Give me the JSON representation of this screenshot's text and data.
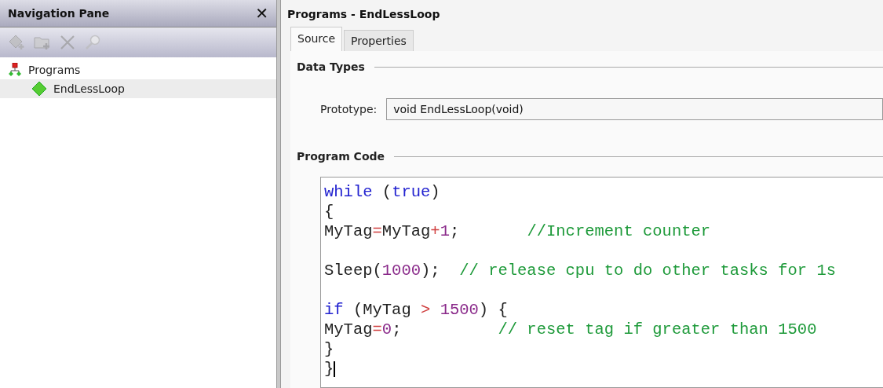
{
  "nav_pane": {
    "title": "Navigation Pane",
    "close": "✕",
    "toolbar": [
      {
        "kind": "add-item",
        "disabled": true
      },
      {
        "kind": "add-folder",
        "disabled": true
      },
      {
        "kind": "delete",
        "disabled": true
      },
      {
        "kind": "search",
        "disabled": true
      }
    ],
    "tree": [
      {
        "label": "Programs",
        "kind": "group",
        "selected": false,
        "children": [
          {
            "label": "EndLessLoop",
            "kind": "program",
            "selected": true
          }
        ]
      }
    ]
  },
  "editor": {
    "title": "Programs - EndLessLoop",
    "tabs": [
      {
        "label": "Source",
        "selected": true
      },
      {
        "label": "Properties",
        "selected": false
      }
    ],
    "data_types": {
      "heading": "Data Types",
      "prototype_label": "Prototype:",
      "prototype_value": "void EndLessLoop(void)"
    },
    "program_code": {
      "heading": "Program Code",
      "blocks": [
        {
          "lines": [
            {
              "tokens": [
                {
                  "kind": "keyword",
                  "text": "while"
                },
                {
                  "kind": "plain",
                  "text": " ("
                },
                {
                  "kind": "keyword",
                  "text": "true"
                },
                {
                  "kind": "plain",
                  "text": ")"
                }
              ]
            },
            {
              "tokens": [
                {
                  "kind": "plain",
                  "text": "{"
                }
              ]
            },
            {
              "tokens": [
                {
                  "kind": "plain",
                  "text": "MyTag"
                },
                {
                  "kind": "operator",
                  "text": "="
                },
                {
                  "kind": "plain",
                  "text": "MyTag"
                },
                {
                  "kind": "operator",
                  "text": "+"
                },
                {
                  "kind": "number",
                  "text": "1"
                },
                {
                  "kind": "plain",
                  "text": ";       "
                },
                {
                  "kind": "comment",
                  "text": "//Increment counter"
                }
              ]
            }
          ]
        },
        {
          "lines": [
            {
              "tokens": [
                {
                  "kind": "plain",
                  "text": "Sleep("
                },
                {
                  "kind": "number",
                  "text": "1000"
                },
                {
                  "kind": "plain",
                  "text": ");  "
                },
                {
                  "kind": "comment",
                  "text": "// release cpu to do other tasks for 1s"
                }
              ]
            }
          ]
        },
        {
          "lines": [
            {
              "tokens": [
                {
                  "kind": "keyword",
                  "text": "if"
                },
                {
                  "kind": "plain",
                  "text": " (MyTag "
                },
                {
                  "kind": "operator",
                  "text": "> "
                },
                {
                  "kind": "number",
                  "text": "1500"
                },
                {
                  "kind": "plain",
                  "text": ") {"
                }
              ]
            },
            {
              "tokens": [
                {
                  "kind": "plain",
                  "text": "MyTag"
                },
                {
                  "kind": "operator",
                  "text": "="
                },
                {
                  "kind": "number",
                  "text": "0"
                },
                {
                  "kind": "plain",
                  "text": ";          "
                },
                {
                  "kind": "comment",
                  "text": "// reset tag if greater than 1500"
                }
              ]
            },
            {
              "tokens": [
                {
                  "kind": "plain",
                  "text": "}"
                }
              ]
            },
            {
              "caret": true,
              "tokens": [
                {
                  "kind": "plain",
                  "text": "}"
                }
              ]
            }
          ]
        }
      ]
    }
  }
}
